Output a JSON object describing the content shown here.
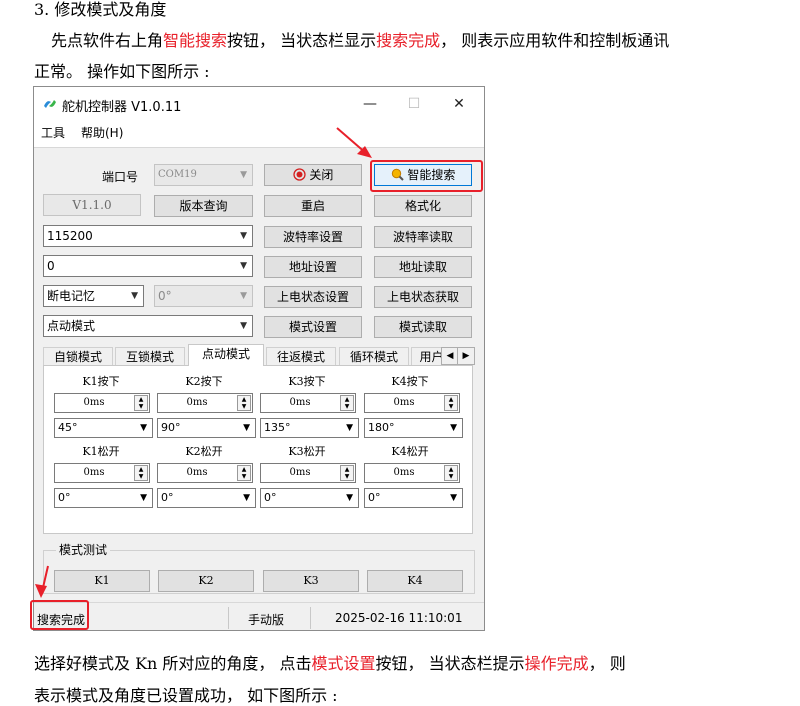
{
  "doc": {
    "heading": "3. 修改模式及角度",
    "para1_a": "先点软件右上角",
    "para1_b": "智能搜索",
    "para1_c": "按钮，  当状态栏显示",
    "para1_d": "搜索完成",
    "para1_e": "，  则表示应用软件和控制板通讯",
    "para1_line2": "正常。 操作如下图所示 :",
    "para2_a": "选择好模式及 Kn 所对应的角度，  点击",
    "para2_b": "模式设置",
    "para2_c": "按钮，  当状态栏提示",
    "para2_d": "操作完成",
    "para2_e": "，  则",
    "para2_line2": "表示模式及角度已设置成功，  如下图所示 :"
  },
  "window": {
    "title": "舵机控制器 V1.0.11",
    "minimize": "—",
    "maximize": "☐",
    "close": "✕",
    "menu": [
      "工具",
      "帮助(H)"
    ]
  },
  "controls": {
    "port_label": "端口号",
    "port_value": "COM19",
    "close_btn": "关闭",
    "smart_search_btn": "智能搜索",
    "version_value": "V1.1.0",
    "version_query_btn": "版本查询",
    "restart_btn": "重启",
    "format_btn": "格式化",
    "baud_value": "115200",
    "baud_set_btn": "波特率设置",
    "baud_read_btn": "波特率读取",
    "addr_value": "0",
    "addr_set_btn": "地址设置",
    "addr_read_btn": "地址读取",
    "power_mode_value": "断电记忆",
    "power_angle_value": "0°",
    "power_set_btn": "上电状态设置",
    "power_get_btn": "上电状态获取",
    "mode_value": "点动模式",
    "mode_set_btn": "模式设置",
    "mode_read_btn": "模式读取"
  },
  "tabs": [
    "自锁模式",
    "互锁模式",
    "点动模式",
    "往返模式",
    "循环模式",
    "用户"
  ],
  "active_tab": "点动模式",
  "keys": {
    "press_labels": [
      "K1按下",
      "K2按下",
      "K3按下",
      "K4按下"
    ],
    "press_times": [
      "0ms",
      "0ms",
      "0ms",
      "0ms"
    ],
    "press_angles": [
      "45°",
      "90°",
      "135°",
      "180°"
    ],
    "release_labels": [
      "K1松开",
      "K2松开",
      "K3松开",
      "K4松开"
    ],
    "release_times": [
      "0ms",
      "0ms",
      "0ms",
      "0ms"
    ],
    "release_angles": [
      "0°",
      "0°",
      "0°",
      "0°"
    ]
  },
  "mode_test": {
    "title": "模式测试",
    "buttons": [
      "K1",
      "K2",
      "K3",
      "K4"
    ]
  },
  "status": {
    "message": "搜索完成",
    "edition": "手动版",
    "datetime": "2025-02-16 11:10:01"
  },
  "colors": {
    "highlight": "#e8202a",
    "accent": "#0078d7"
  }
}
